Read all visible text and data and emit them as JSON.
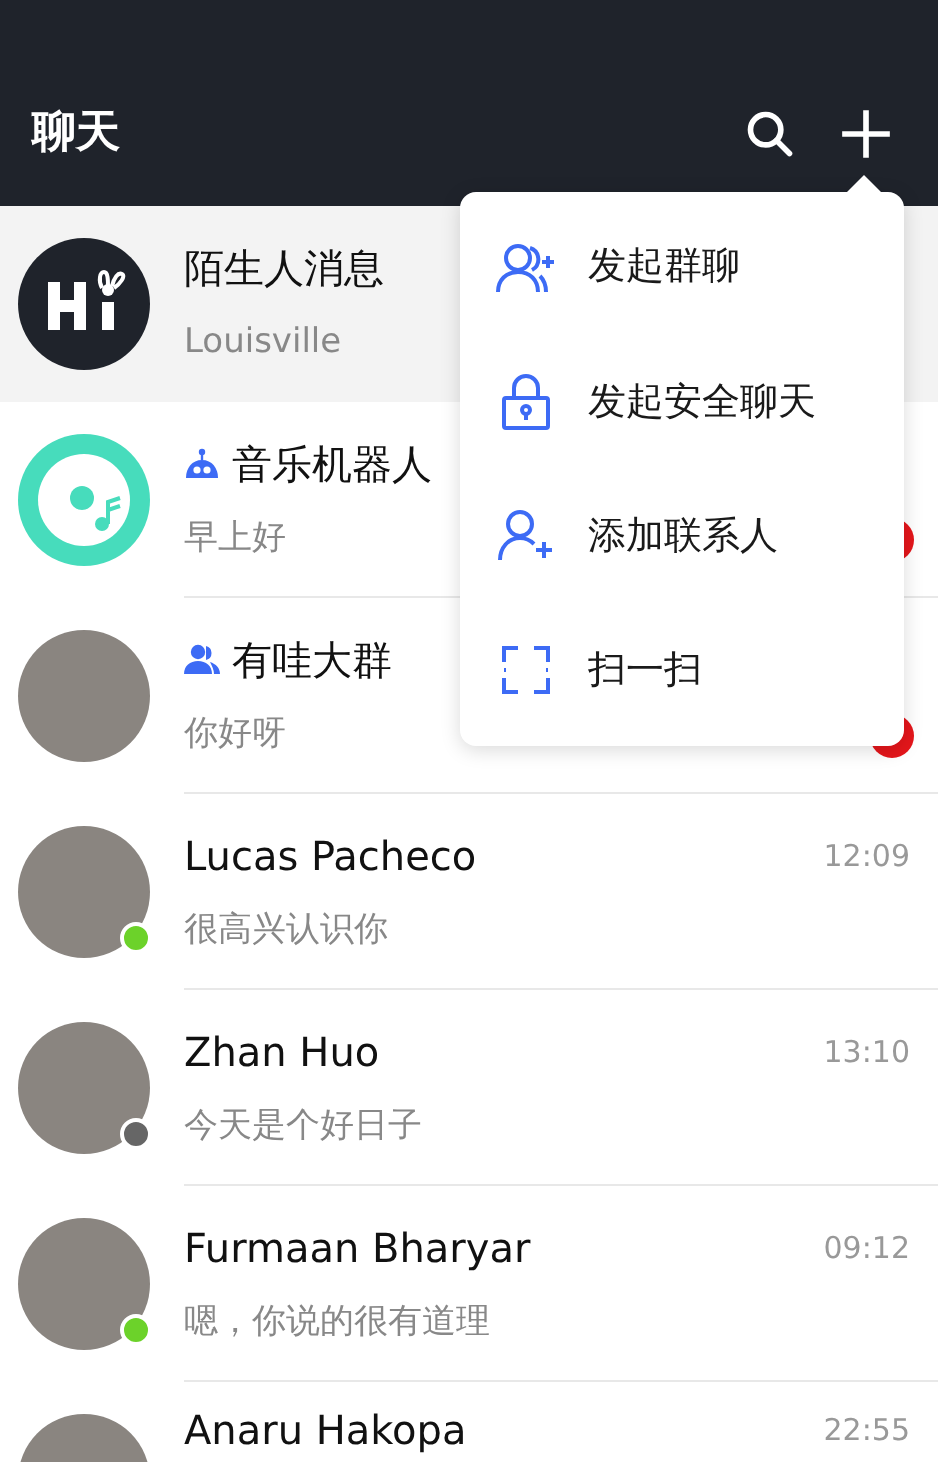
{
  "header": {
    "title": "聊天"
  },
  "chats": [
    {
      "kind": "system",
      "name": "陌生人消息",
      "preview": "Louisville",
      "selected": true,
      "unread": false
    },
    {
      "kind": "bot",
      "name": "音乐机器人",
      "preview": "早上好",
      "selected": false,
      "unread": true
    },
    {
      "kind": "group",
      "name": "有哇大群",
      "preview": "你好呀",
      "selected": false,
      "unread": true
    },
    {
      "kind": "contact",
      "name": "Lucas Pacheco",
      "preview": "很高兴认识你",
      "time": "12:09",
      "selected": false,
      "unread": false,
      "color": "#6cd22a"
    },
    {
      "kind": "contact",
      "name": "Zhan Huo",
      "preview": "今天是个好日子",
      "time": "13:10",
      "selected": false,
      "unread": false,
      "color": "#666666"
    },
    {
      "kind": "contact",
      "name": "Furmaan Bharyar",
      "preview": "嗯，你说的很有道理",
      "time": "09:12",
      "selected": false,
      "unread": false,
      "color": "#6cd22a"
    },
    {
      "kind": "contact",
      "name": "Anaru Hakopa",
      "time": "22:55",
      "selected": false,
      "unread": false
    }
  ],
  "menu": [
    {
      "kind": "group",
      "label": "发起群聊"
    },
    {
      "kind": "lock",
      "label": "发起安全聊天"
    },
    {
      "kind": "add",
      "label": "添加联系人"
    },
    {
      "kind": "scan",
      "label": "扫一扫"
    }
  ]
}
